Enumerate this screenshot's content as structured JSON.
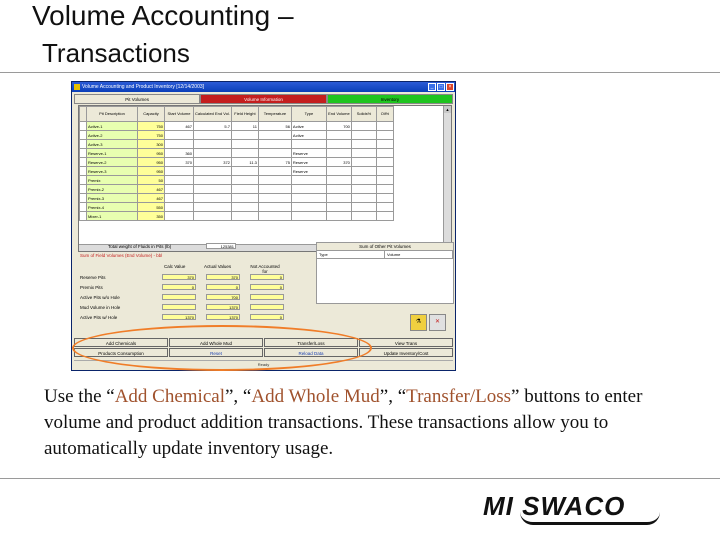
{
  "slide": {
    "title": "Volume Accounting –",
    "subtitle": "Transactions"
  },
  "window": {
    "title": "Volume Accounting and Product Inventory [12/14/2003]",
    "tabs": [
      "Pit Volumes",
      "Volume Information",
      "Inventory"
    ]
  },
  "grid": {
    "group_header": "Pit Volumes - bbl",
    "columns": [
      "Pit Description",
      "Capacity",
      "Start Volume",
      "Calculated End Vol.",
      "Field Height",
      "Temperature",
      "Type",
      "End Volume",
      "Solids%",
      "Oil%"
    ],
    "rows": [
      {
        "name": "Active-1",
        "cap": "750",
        "start": "467",
        "calc": "5.7",
        "field": "11",
        "temp": "56",
        "type": "Active",
        "end": "700"
      },
      {
        "name": "Active-2",
        "cap": "750",
        "start": "",
        "calc": "",
        "field": "",
        "temp": "",
        "type": "Active",
        "end": ""
      },
      {
        "name": "Active-3",
        "cap": "300",
        "start": "",
        "calc": "",
        "field": "",
        "temp": "",
        "type": "",
        "end": ""
      },
      {
        "name": "Reserve-1",
        "cap": "950",
        "start": "360",
        "calc": "",
        "field": "",
        "temp": "",
        "type": "Reserve",
        "end": ""
      },
      {
        "name": "Reserve-2",
        "cap": "950",
        "start": "370",
        "calc": "372",
        "field": "11.3",
        "temp": "75",
        "type": "Reserve",
        "end": "370"
      },
      {
        "name": "Reserve-3",
        "cap": "950",
        "start": "",
        "calc": "",
        "field": "",
        "temp": "",
        "type": "Reserve",
        "end": ""
      },
      {
        "name": "Premix",
        "cap": "50",
        "start": "",
        "calc": "",
        "field": "",
        "temp": "",
        "type": "",
        "end": ""
      },
      {
        "name": "Premix-2",
        "cap": "467",
        "start": "",
        "calc": "",
        "field": "",
        "temp": "",
        "type": "",
        "end": ""
      },
      {
        "name": "Premix-3",
        "cap": "467",
        "start": "",
        "calc": "",
        "field": "",
        "temp": "",
        "type": "",
        "end": ""
      },
      {
        "name": "Premix-4",
        "cap": "550",
        "start": "",
        "calc": "",
        "field": "",
        "temp": "",
        "type": "",
        "end": ""
      },
      {
        "name": "Mixer-1",
        "cap": "350",
        "start": "",
        "calc": "",
        "field": "",
        "temp": "",
        "type": "",
        "end": ""
      }
    ]
  },
  "lower": {
    "total_weight_label": "Total weight of Fluids in Pits (lb)",
    "total_weight_value": "125381",
    "sum_pit_label": "Sum of Field Volumes (End Volume) - bbl",
    "col_calc": "Calc Value",
    "col_actual": "Actual Values",
    "col_not_acc": "Not Accounted for",
    "rows": [
      {
        "label": "Reserve Pits",
        "calc": "370",
        "actual": "370",
        "na": "0"
      },
      {
        "label": "Premix Pits",
        "calc": "0",
        "actual": "0",
        "na": "0"
      },
      {
        "label": "Active Pits w/o Hole",
        "calc": "",
        "actual": "700",
        "na": ""
      },
      {
        "label": "Mud Volume in Hole",
        "calc": "",
        "actual": "1370",
        "na": ""
      },
      {
        "label": "Active Pits w/ Hole",
        "calc": "1370",
        "actual": "1370",
        "na": "0"
      }
    ],
    "other_pit_title": "Sum of Other Pit Volumes",
    "other_pit_cols": [
      "Type",
      "Volume"
    ]
  },
  "buttons": {
    "row1": [
      "Add Chemicals",
      "Add Whole Mud",
      "Transfer/Loss",
      "View Trans"
    ],
    "row2": [
      "Products Consumption",
      "Reset",
      "Reload Data",
      "Update Inventory/Cost"
    ]
  },
  "status": "Ready",
  "description": {
    "pre": "Use the “",
    "b1": "Add Chemical",
    "mid1": "”, “",
    "b2": "Add Whole Mud",
    "mid2": "”, “",
    "b3": "Transfer/Loss",
    "post": "” buttons to enter volume and product addition transactions.  These transactions allow you to automatically update inventory usage."
  },
  "logo": {
    "text": "MI SWACO"
  },
  "colors": {
    "highlight": "#f07d28",
    "tab_red": "#c41e1e",
    "tab_green": "#1fc41f"
  }
}
